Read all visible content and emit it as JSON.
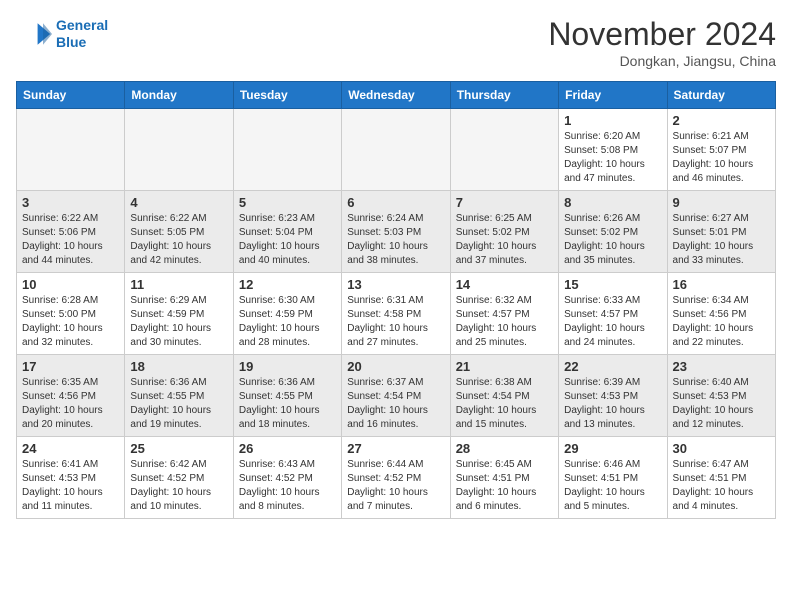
{
  "header": {
    "logo_line1": "General",
    "logo_line2": "Blue",
    "month": "November 2024",
    "location": "Dongkan, Jiangsu, China"
  },
  "weekdays": [
    "Sunday",
    "Monday",
    "Tuesday",
    "Wednesday",
    "Thursday",
    "Friday",
    "Saturday"
  ],
  "weeks": [
    [
      {
        "day": "",
        "info": "",
        "empty": true
      },
      {
        "day": "",
        "info": "",
        "empty": true
      },
      {
        "day": "",
        "info": "",
        "empty": true
      },
      {
        "day": "",
        "info": "",
        "empty": true
      },
      {
        "day": "",
        "info": "",
        "empty": true
      },
      {
        "day": "1",
        "info": "Sunrise: 6:20 AM\nSunset: 5:08 PM\nDaylight: 10 hours\nand 47 minutes.",
        "empty": false
      },
      {
        "day": "2",
        "info": "Sunrise: 6:21 AM\nSunset: 5:07 PM\nDaylight: 10 hours\nand 46 minutes.",
        "empty": false
      }
    ],
    [
      {
        "day": "3",
        "info": "Sunrise: 6:22 AM\nSunset: 5:06 PM\nDaylight: 10 hours\nand 44 minutes.",
        "empty": false
      },
      {
        "day": "4",
        "info": "Sunrise: 6:22 AM\nSunset: 5:05 PM\nDaylight: 10 hours\nand 42 minutes.",
        "empty": false
      },
      {
        "day": "5",
        "info": "Sunrise: 6:23 AM\nSunset: 5:04 PM\nDaylight: 10 hours\nand 40 minutes.",
        "empty": false
      },
      {
        "day": "6",
        "info": "Sunrise: 6:24 AM\nSunset: 5:03 PM\nDaylight: 10 hours\nand 38 minutes.",
        "empty": false
      },
      {
        "day": "7",
        "info": "Sunrise: 6:25 AM\nSunset: 5:02 PM\nDaylight: 10 hours\nand 37 minutes.",
        "empty": false
      },
      {
        "day": "8",
        "info": "Sunrise: 6:26 AM\nSunset: 5:02 PM\nDaylight: 10 hours\nand 35 minutes.",
        "empty": false
      },
      {
        "day": "9",
        "info": "Sunrise: 6:27 AM\nSunset: 5:01 PM\nDaylight: 10 hours\nand 33 minutes.",
        "empty": false
      }
    ],
    [
      {
        "day": "10",
        "info": "Sunrise: 6:28 AM\nSunset: 5:00 PM\nDaylight: 10 hours\nand 32 minutes.",
        "empty": false
      },
      {
        "day": "11",
        "info": "Sunrise: 6:29 AM\nSunset: 4:59 PM\nDaylight: 10 hours\nand 30 minutes.",
        "empty": false
      },
      {
        "day": "12",
        "info": "Sunrise: 6:30 AM\nSunset: 4:59 PM\nDaylight: 10 hours\nand 28 minutes.",
        "empty": false
      },
      {
        "day": "13",
        "info": "Sunrise: 6:31 AM\nSunset: 4:58 PM\nDaylight: 10 hours\nand 27 minutes.",
        "empty": false
      },
      {
        "day": "14",
        "info": "Sunrise: 6:32 AM\nSunset: 4:57 PM\nDaylight: 10 hours\nand 25 minutes.",
        "empty": false
      },
      {
        "day": "15",
        "info": "Sunrise: 6:33 AM\nSunset: 4:57 PM\nDaylight: 10 hours\nand 24 minutes.",
        "empty": false
      },
      {
        "day": "16",
        "info": "Sunrise: 6:34 AM\nSunset: 4:56 PM\nDaylight: 10 hours\nand 22 minutes.",
        "empty": false
      }
    ],
    [
      {
        "day": "17",
        "info": "Sunrise: 6:35 AM\nSunset: 4:56 PM\nDaylight: 10 hours\nand 20 minutes.",
        "empty": false
      },
      {
        "day": "18",
        "info": "Sunrise: 6:36 AM\nSunset: 4:55 PM\nDaylight: 10 hours\nand 19 minutes.",
        "empty": false
      },
      {
        "day": "19",
        "info": "Sunrise: 6:36 AM\nSunset: 4:55 PM\nDaylight: 10 hours\nand 18 minutes.",
        "empty": false
      },
      {
        "day": "20",
        "info": "Sunrise: 6:37 AM\nSunset: 4:54 PM\nDaylight: 10 hours\nand 16 minutes.",
        "empty": false
      },
      {
        "day": "21",
        "info": "Sunrise: 6:38 AM\nSunset: 4:54 PM\nDaylight: 10 hours\nand 15 minutes.",
        "empty": false
      },
      {
        "day": "22",
        "info": "Sunrise: 6:39 AM\nSunset: 4:53 PM\nDaylight: 10 hours\nand 13 minutes.",
        "empty": false
      },
      {
        "day": "23",
        "info": "Sunrise: 6:40 AM\nSunset: 4:53 PM\nDaylight: 10 hours\nand 12 minutes.",
        "empty": false
      }
    ],
    [
      {
        "day": "24",
        "info": "Sunrise: 6:41 AM\nSunset: 4:53 PM\nDaylight: 10 hours\nand 11 minutes.",
        "empty": false
      },
      {
        "day": "25",
        "info": "Sunrise: 6:42 AM\nSunset: 4:52 PM\nDaylight: 10 hours\nand 10 minutes.",
        "empty": false
      },
      {
        "day": "26",
        "info": "Sunrise: 6:43 AM\nSunset: 4:52 PM\nDaylight: 10 hours\nand 8 minutes.",
        "empty": false
      },
      {
        "day": "27",
        "info": "Sunrise: 6:44 AM\nSunset: 4:52 PM\nDaylight: 10 hours\nand 7 minutes.",
        "empty": false
      },
      {
        "day": "28",
        "info": "Sunrise: 6:45 AM\nSunset: 4:51 PM\nDaylight: 10 hours\nand 6 minutes.",
        "empty": false
      },
      {
        "day": "29",
        "info": "Sunrise: 6:46 AM\nSunset: 4:51 PM\nDaylight: 10 hours\nand 5 minutes.",
        "empty": false
      },
      {
        "day": "30",
        "info": "Sunrise: 6:47 AM\nSunset: 4:51 PM\nDaylight: 10 hours\nand 4 minutes.",
        "empty": false
      }
    ]
  ]
}
